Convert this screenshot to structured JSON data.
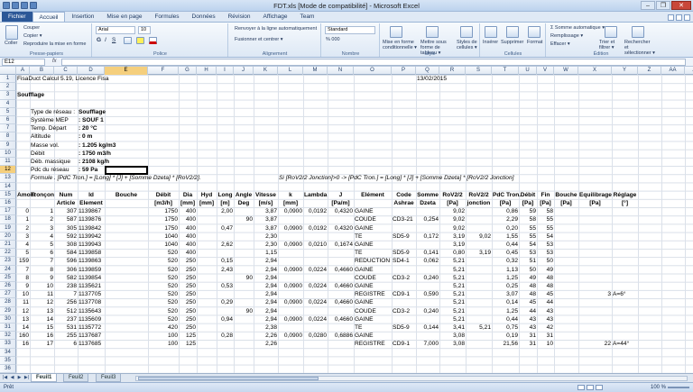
{
  "window": {
    "title": "FDT.xls [Mode de compatibilité] - Microsoft Excel",
    "controls": [
      "–",
      "❐",
      "✕"
    ]
  },
  "ribbon_tabs": [
    "Fichier",
    "Accueil",
    "Insertion",
    "Mise en page",
    "Formules",
    "Données",
    "Révision",
    "Affichage",
    "Team"
  ],
  "active_tab": "Accueil",
  "ribbon": {
    "clipboard": {
      "label": "Presse-papiers",
      "coller": "Coller",
      "couper": "Couper",
      "copier": "Copier ▾",
      "reproduire": "Reproduire la mise en forme"
    },
    "police": {
      "label": "Police",
      "font": "Arial",
      "size": "10",
      "bold": "G",
      "italic": "I",
      "underline": "S"
    },
    "alignement": {
      "label": "Alignement",
      "wrap": "Renvoyer à la ligne automatiquement",
      "merge": "Fusionner et centrer ▾"
    },
    "nombre": {
      "label": "Nombre",
      "format": "Standard"
    },
    "style": {
      "label": "Style",
      "cond": "Mise en forme conditionnelle ▾",
      "table": "Mettre sous forme de tableau ▾",
      "cell": "Styles de cellules ▾"
    },
    "cellules": {
      "label": "Cellules",
      "insert": "Insérer",
      "delete": "Supprimer",
      "format": "Format"
    },
    "edition": {
      "label": "Édition",
      "sum": "Σ Somme automatique ▾",
      "fill": "Remplissage ▾",
      "clear": "Effacer ▾",
      "sort": "Trier et filtrer ▾",
      "find": "Rechercher et sélectionner ▾"
    }
  },
  "formula_bar": {
    "name_box": "E12",
    "fx": "fx",
    "formula": ""
  },
  "columns": [
    "A",
    "B",
    "C",
    "D",
    "E",
    "F",
    "G",
    "H",
    "I",
    "J",
    "K",
    "L",
    "M",
    "N",
    "O",
    "P",
    "Q",
    "R",
    "S",
    "T",
    "U",
    "V",
    "W",
    "X",
    "Y",
    "Z",
    "AA",
    "AB",
    "AC"
  ],
  "selected_column": "E",
  "row_numbers": [
    "1",
    "2",
    "3",
    "4",
    "5",
    "6",
    "7",
    "8",
    "9",
    "10",
    "11",
    "12",
    "13",
    "14",
    "15",
    "16",
    "17",
    "18",
    "19",
    "20",
    "21",
    "22",
    "23",
    "24",
    "25",
    "26",
    "27",
    "28",
    "29",
    "30",
    "31",
    "32",
    "33",
    "34",
    "35",
    "36"
  ],
  "selected_row": "12",
  "header": {
    "title": "FisaDuct Calcul 5.19, Licence Fisa",
    "date": "13/02/2015",
    "section": "Soufflage",
    "params": [
      {
        "label": "Type de réseau :",
        "value": "Soufflage"
      },
      {
        "label": "Système MEP",
        "value": ":  SOUF 1"
      },
      {
        "label": "Temp. Départ",
        "value": ":  20 °C"
      },
      {
        "label": "Altitude",
        "value": ":  0 m"
      },
      {
        "label": "Masse vol.",
        "value": ":  1.205 kg/m3"
      },
      {
        "label": "Débit",
        "value": ":  1750 m3/h"
      },
      {
        "label": "Déb. massique",
        "value": ":  2108 kg/h"
      },
      {
        "label": "Pdc du réseau",
        "value": ":  59 Pa"
      }
    ],
    "formula1": "Formule . [PdC Tron.] = [Long] * [J] + [Somme Dzeta] * [RoV2/2].",
    "formula2": "Si [RoV2/2 Jonction]>0 -> [PdC Tron.] = [Long] * [J] + [Somme Dzeta] * [RoV2/2 Jonction]"
  },
  "table_headers": {
    "line1": [
      "Amont",
      "Tronçon",
      "Num",
      "Id",
      "Bouche",
      "Débit",
      "Dia",
      "Hyd",
      "Long",
      "Angle",
      "Vitesse",
      "k",
      "Lambda",
      "J",
      "Elément",
      "Code",
      "Somme",
      "RoV2/2",
      "RoV2/2",
      "PdC Tron.",
      "Débit",
      "Fin",
      "Bouche",
      "Equilibrage",
      "Réglage"
    ],
    "line2": [
      "",
      "",
      "Article",
      "Element",
      "",
      "[m3/h]",
      "[mm]",
      "[mm]",
      "[m]",
      "Deg",
      "[m/s]",
      "[mm]",
      "",
      "[Pa/m]",
      "",
      "Ashrae",
      "Dzeta",
      "[Pa]",
      "jonction",
      "[Pa]",
      "[Pa]",
      "[Pa]",
      "[Pa]",
      "[Pa]",
      "[°]"
    ]
  },
  "rows": [
    [
      "0",
      "1",
      "307",
      "1139867",
      "",
      "1750",
      "400",
      "2,00",
      "",
      "3,87",
      "0,0900",
      "0,0192",
      "0,4320",
      "GAINE",
      "",
      "",
      "9,02",
      "",
      "0,86",
      "59",
      "58",
      "",
      "",
      ""
    ],
    [
      "1",
      "2",
      "587",
      "1139876",
      "",
      "1750",
      "400",
      "",
      "90",
      "3,87",
      "",
      "",
      "",
      "COUDE",
      "CD3-21",
      "0,254",
      "9,02",
      "",
      "2,29",
      "58",
      "55",
      "",
      "",
      ""
    ],
    [
      "2",
      "3",
      "305",
      "1139842",
      "",
      "1750",
      "400",
      "0,47",
      "",
      "3,87",
      "0,0900",
      "0,0192",
      "0,4320",
      "GAINE",
      "",
      "",
      "9,02",
      "",
      "0,20",
      "55",
      "55",
      "",
      "",
      ""
    ],
    [
      "3",
      "4",
      "592",
      "1139942",
      "",
      "1040",
      "400",
      "",
      "",
      "2,30",
      "",
      "",
      "",
      "TE",
      "SD5-9",
      "0,172",
      "3,19",
      "9,02",
      "1,55",
      "55",
      "54",
      "",
      "",
      ""
    ],
    [
      "4",
      "5",
      "308",
      "1139943",
      "",
      "1040",
      "400",
      "2,62",
      "",
      "2,30",
      "0,0900",
      "0,0210",
      "0,1674",
      "GAINE",
      "",
      "",
      "3,19",
      "",
      "0,44",
      "54",
      "53",
      "",
      "",
      ""
    ],
    [
      "5",
      "6",
      "584",
      "1139858",
      "",
      "520",
      "400",
      "",
      "",
      "1,15",
      "",
      "",
      "",
      "TE",
      "SD5-9",
      "0,141",
      "0,80",
      "3,19",
      "0,45",
      "53",
      "53",
      "",
      "",
      ""
    ],
    [
      "159",
      "7",
      "596",
      "1139863",
      "",
      "520",
      "250",
      "0,15",
      "",
      "2,94",
      "",
      "",
      "",
      "REDUCTION",
      "SD4-1",
      "0,062",
      "5,21",
      "",
      "0,32",
      "51",
      "50",
      "",
      "",
      ""
    ],
    [
      "7",
      "8",
      "306",
      "1139859",
      "",
      "520",
      "250",
      "2,43",
      "",
      "2,94",
      "0,0900",
      "0,0224",
      "0,4660",
      "GAINE",
      "",
      "",
      "5,21",
      "",
      "1,13",
      "50",
      "49",
      "",
      "",
      ""
    ],
    [
      "8",
      "9",
      "582",
      "1139854",
      "",
      "520",
      "250",
      "",
      "90",
      "2,94",
      "",
      "",
      "",
      "COUDE",
      "CD3-2",
      "0,240",
      "5,21",
      "",
      "1,25",
      "49",
      "48",
      "",
      "",
      ""
    ],
    [
      "9",
      "10",
      "238",
      "1135621",
      "",
      "520",
      "250",
      "0,53",
      "",
      "2,94",
      "0,0900",
      "0,0224",
      "0,4660",
      "GAINE",
      "",
      "",
      "5,21",
      "",
      "0,25",
      "48",
      "48",
      "",
      "",
      ""
    ],
    [
      "10",
      "11",
      "7",
      "1137705",
      "",
      "520",
      "250",
      "",
      "",
      "2,94",
      "",
      "",
      "",
      "REGISTRE",
      "CD9-1",
      "0,590",
      "5,21",
      "",
      "3,07",
      "48",
      "45",
      "",
      "3",
      "A=6°"
    ],
    [
      "11",
      "12",
      "256",
      "1137708",
      "",
      "520",
      "250",
      "0,29",
      "",
      "2,94",
      "0,0900",
      "0,0224",
      "0,4660",
      "GAINE",
      "",
      "",
      "5,21",
      "",
      "0,14",
      "45",
      "44",
      "",
      "",
      ""
    ],
    [
      "12",
      "13",
      "512",
      "1135643",
      "",
      "520",
      "250",
      "",
      "90",
      "2,94",
      "",
      "",
      "",
      "COUDE",
      "CD3-2",
      "0,240",
      "5,21",
      "",
      "1,25",
      "44",
      "43",
      "",
      "",
      ""
    ],
    [
      "13",
      "14",
      "237",
      "1135609",
      "",
      "520",
      "250",
      "0,94",
      "",
      "2,94",
      "0,0900",
      "0,0224",
      "0,4660",
      "GAINE",
      "",
      "",
      "5,21",
      "",
      "0,44",
      "43",
      "43",
      "",
      "",
      ""
    ],
    [
      "14",
      "15",
      "531",
      "1135772",
      "",
      "420",
      "250",
      "",
      "",
      "2,38",
      "",
      "",
      "",
      "TE",
      "SD5-9",
      "0,144",
      "3,41",
      "5,21",
      "0,75",
      "43",
      "42",
      "",
      "",
      ""
    ],
    [
      "160",
      "16",
      "255",
      "1137687",
      "",
      "100",
      "125",
      "0,28",
      "",
      "2,26",
      "0,0900",
      "0,0280",
      "0,6886",
      "GAINE",
      "",
      "",
      "3,08",
      "",
      "0,19",
      "31",
      "31",
      "",
      "",
      ""
    ],
    [
      "16",
      "17",
      "6",
      "1137685",
      "",
      "100",
      "125",
      "",
      "",
      "2,26",
      "",
      "",
      "",
      "REGISTRE",
      "CD9-1",
      "7,000",
      "3,08",
      "",
      "21,56",
      "31",
      "10",
      "",
      "22",
      "A=44°"
    ]
  ],
  "sheet_tabs": [
    "Feuil1",
    "Feuil2",
    "Feuil3"
  ],
  "active_sheet": "Feuil1",
  "status": {
    "ready": "Prêt",
    "zoom": "100 %"
  }
}
